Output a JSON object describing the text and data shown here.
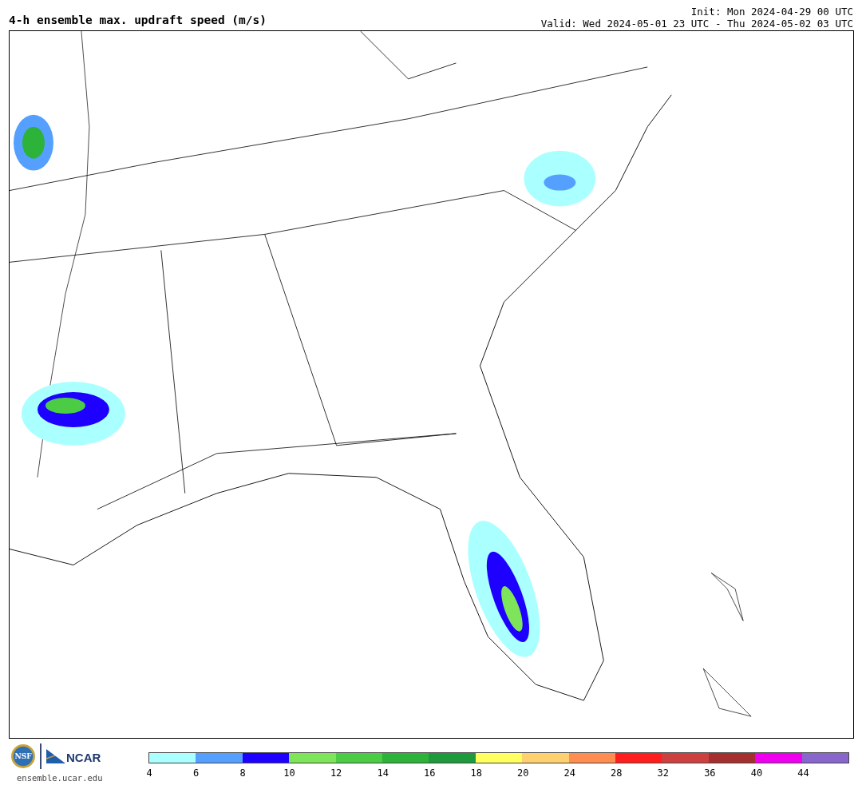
{
  "title": "4-h ensemble max. updraft speed (m/s)",
  "init": "Init: Mon 2024-04-29 00 UTC",
  "valid": "Valid: Wed 2024-05-01 23 UTC - Thu 2024-05-02 03 UTC",
  "logos": [
    {
      "kind": "seal",
      "text": "NSF"
    },
    {
      "kind": "wordmark",
      "text": "NCAR"
    }
  ],
  "site": "ensemble.ucar.edu",
  "colorbar": {
    "bins": [
      {
        "color": "#aaffff",
        "label": "4"
      },
      {
        "color": "#55a0ff",
        "label": "6"
      },
      {
        "color": "#1e00ff",
        "label": "8"
      },
      {
        "color": "#7ee55a",
        "label": "10"
      },
      {
        "color": "#4ccc44",
        "label": "12"
      },
      {
        "color": "#2db23a",
        "label": "14"
      },
      {
        "color": "#1e9a3c",
        "label": "16"
      },
      {
        "color": "#ffff60",
        "label": "18"
      },
      {
        "color": "#ffd070",
        "label": "20"
      },
      {
        "color": "#ff8c50",
        "label": "24"
      },
      {
        "color": "#ff1e1e",
        "label": "28"
      },
      {
        "color": "#cc4040",
        "label": "32"
      },
      {
        "color": "#a52e2e",
        "label": "36"
      },
      {
        "color": "#ee00ee",
        "label": "40"
      },
      {
        "color": "#8866cc",
        "label": "44"
      }
    ]
  }
}
